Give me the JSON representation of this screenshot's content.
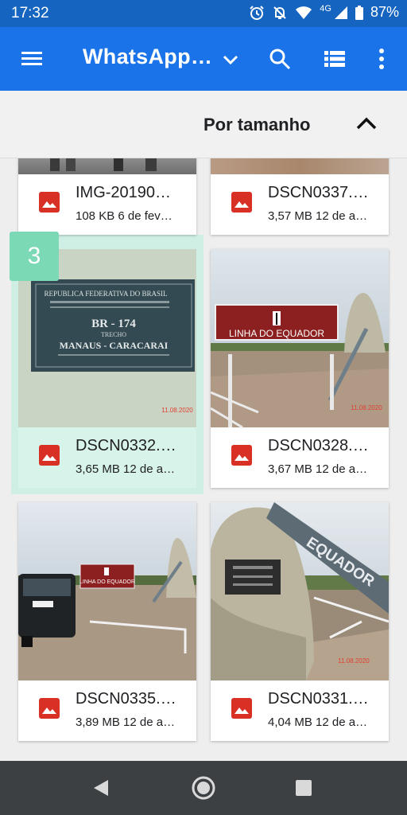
{
  "status_bar": {
    "time": "17:32",
    "network": "4G",
    "battery": "87%"
  },
  "app_bar": {
    "title": "WhatsApp…",
    "icons": [
      "menu-icon",
      "chevron-down-icon",
      "search-icon",
      "list-view-icon",
      "more-vert-icon"
    ]
  },
  "sort_bar": {
    "label": "Por tamanho",
    "direction_icon": "chevron-up-icon"
  },
  "selection": {
    "count": "3"
  },
  "files": [
    {
      "name": "IMG-20190…",
      "meta": "108 KB 6 de fev…"
    },
    {
      "name": "DSCN0337.…",
      "meta": "3,57 MB 12 de a…"
    },
    {
      "name": "DSCN0332.…",
      "meta": "3,65 MB 12 de a…",
      "selected": true
    },
    {
      "name": "DSCN0328.…",
      "meta": "3,67 MB 12 de a…"
    },
    {
      "name": "DSCN0335.…",
      "meta": "3,89 MB 12 de a…"
    },
    {
      "name": "DSCN0331.…",
      "meta": "4,04 MB 12 de a…"
    }
  ],
  "thumbnails": {
    "plaque": {
      "line1": "REPUBLICA FEDERATIVA DO BRASIL",
      "road": "BR - 174",
      "route": "MANAUS - CARACARAI",
      "trecho": "TRECHO",
      "date": "11.08.2020"
    },
    "sign": {
      "text": "LINHA DO EQUADOR",
      "date": "11.08.2020"
    },
    "car": {
      "sign_text": "LINHA DO EQUADOR"
    },
    "monument": {
      "text": "EQUADOR",
      "date": "11.08.2020"
    }
  },
  "colors": {
    "status_bar": "#1565c0",
    "app_bar": "#1a73e8",
    "image_icon": "#d93025",
    "selection": "#7bd9b6",
    "nav_bar": "#3c4043"
  }
}
